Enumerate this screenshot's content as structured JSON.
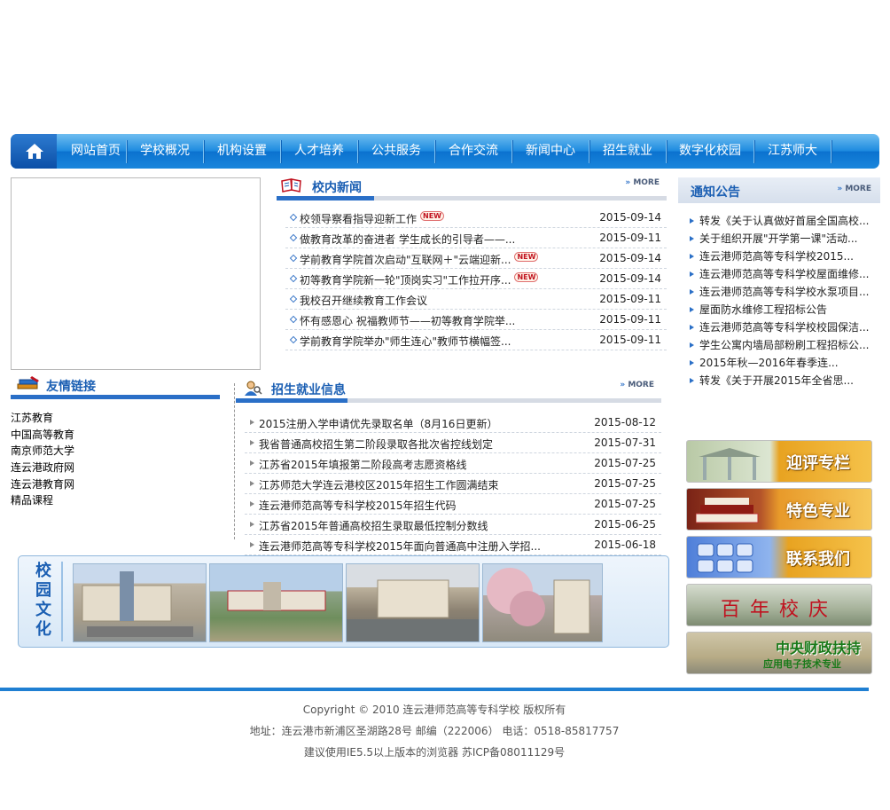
{
  "nav": {
    "items": [
      "网站首页",
      "学校概况",
      "机构设置",
      "人才培养",
      "公共服务",
      "合作交流",
      "新闻中心",
      "招生就业",
      "数字化校园",
      "江苏师大"
    ]
  },
  "campus_news": {
    "title": "校内新闻",
    "more_label": "MORE",
    "items": [
      {
        "text": "校领导察看指导迎新工作",
        "date": "2015-09-14",
        "new": "NEW"
      },
      {
        "text": "做教育改革的奋进者 学生成长的引导者——...",
        "date": "2015-09-11",
        "new": ""
      },
      {
        "text": "学前教育学院首次启动\"互联网＋\"云端迎新...",
        "date": "2015-09-14",
        "new": "NEW"
      },
      {
        "text": "初等教育学院新一轮\"顶岗实习\"工作拉开序...",
        "date": "2015-09-14",
        "new": "NEW"
      },
      {
        "text": "我校召开继续教育工作会议",
        "date": "2015-09-11",
        "new": ""
      },
      {
        "text": "怀有感恩心 祝福教师节——初等教育学院举...",
        "date": "2015-09-11",
        "new": ""
      },
      {
        "text": "学前教育学院举办\"师生连心\"教师节横幅签...",
        "date": "2015-09-11",
        "new": ""
      }
    ]
  },
  "notice": {
    "title": "通知公告",
    "more_label": "MORE",
    "items": [
      "转发《关于认真做好首届全国高校...",
      "关于组织开展\"开学第一课\"活动...",
      "连云港师范高等专科学校2015...",
      "连云港师范高等专科学校屋面维修...",
      "连云港师范高等专科学校水泵项目...",
      "屋面防水维修工程招标公告",
      "连云港师范高等专科学校校园保洁...",
      "学生公寓内墙局部粉刷工程招标公...",
      "2015年秋—2016年春季连...",
      "转发《关于开展2015年全省思..."
    ]
  },
  "friend_links": {
    "title": "友情链接",
    "items": [
      "江苏教育",
      "中国高等教育",
      "南京师范大学",
      "连云港政府网",
      "连云港教育网",
      "精品课程"
    ]
  },
  "admission": {
    "title": "招生就业信息",
    "more_label": "MORE",
    "items": [
      {
        "text": "2015注册入学申请优先录取名单（8月16日更新）",
        "date": "2015-08-12"
      },
      {
        "text": "我省普通高校招生第二阶段录取各批次省控线划定",
        "date": "2015-07-31"
      },
      {
        "text": "江苏省2015年填报第二阶段高考志愿资格线",
        "date": "2015-07-25"
      },
      {
        "text": "江苏师范大学连云港校区2015年招生工作圆满结束",
        "date": "2015-07-25"
      },
      {
        "text": "连云港师范高等专科学校2015年招生代码",
        "date": "2015-07-25"
      },
      {
        "text": "江苏省2015年普通高校招生录取最低控制分数线",
        "date": "2015-06-25"
      },
      {
        "text": "连云港师范高等专科学校2015年面向普通高中注册入学招...",
        "date": "2015-06-18"
      }
    ]
  },
  "culture": {
    "label": [
      "校",
      "园",
      "文",
      "化"
    ]
  },
  "side_banners": [
    {
      "title": "迎评专栏",
      "sub": ""
    },
    {
      "title": "特色专业",
      "sub": ""
    },
    {
      "title": "联系我们",
      "sub": ""
    },
    {
      "title": "百 年 校 庆",
      "sub": ""
    },
    {
      "title": "中央财政扶持",
      "sub": "应用电子技术专业"
    }
  ],
  "footer": {
    "copyright": "Copyright © 2010 连云港师范高等专科学校 版权所有",
    "address": "地址：连云港市新浦区圣湖路28号 邮编（222006） 电话：0518-85817757",
    "icp": "建议使用IE5.5以上版本的浏览器 苏ICP备08011129号"
  },
  "colors": {
    "nav_blue": "#1f8ce0",
    "title_blue": "#1b5fb3",
    "footer_line": "#1f7fd2"
  }
}
